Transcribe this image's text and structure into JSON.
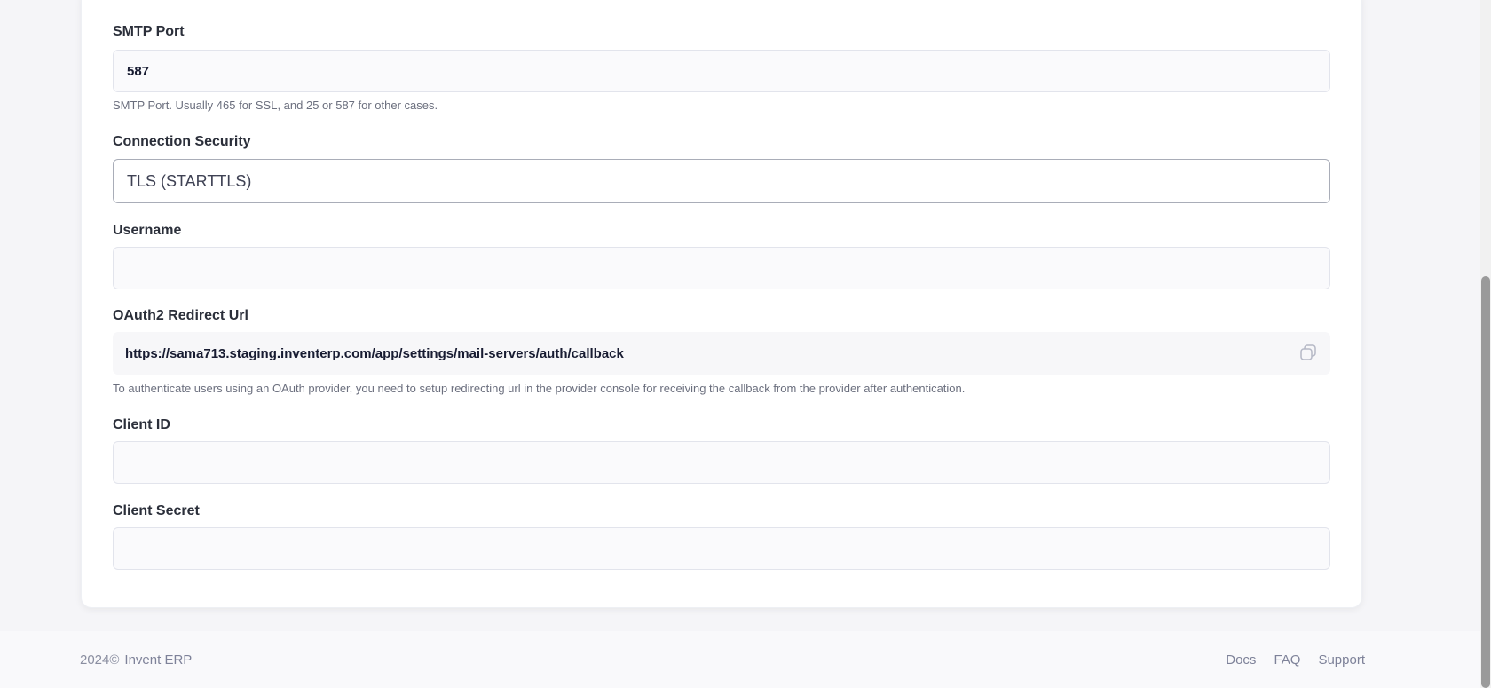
{
  "form": {
    "smtp_port": {
      "label": "SMTP Port",
      "value": "587",
      "hint": "SMTP Port. Usually 465 for SSL, and 25 or 587 for other cases."
    },
    "connection_security": {
      "label": "Connection Security",
      "value": "TLS (STARTTLS)"
    },
    "username": {
      "label": "Username",
      "value": ""
    },
    "oauth_redirect": {
      "label": "OAuth2 Redirect Url",
      "value": "https://sama713.staging.inventerp.com/app/settings/mail-servers/auth/callback",
      "hint": "To authenticate users using an OAuth provider, you need to setup redirecting url in the provider console for receiving the callback from the provider after authentication.",
      "copy_icon": "copy-icon"
    },
    "client_id": {
      "label": "Client ID",
      "value": ""
    },
    "client_secret": {
      "label": "Client Secret",
      "value": ""
    }
  },
  "footer": {
    "copyright": "2024©",
    "brand": "Invent ERP",
    "links": [
      "Docs",
      "FAQ",
      "Support"
    ]
  }
}
